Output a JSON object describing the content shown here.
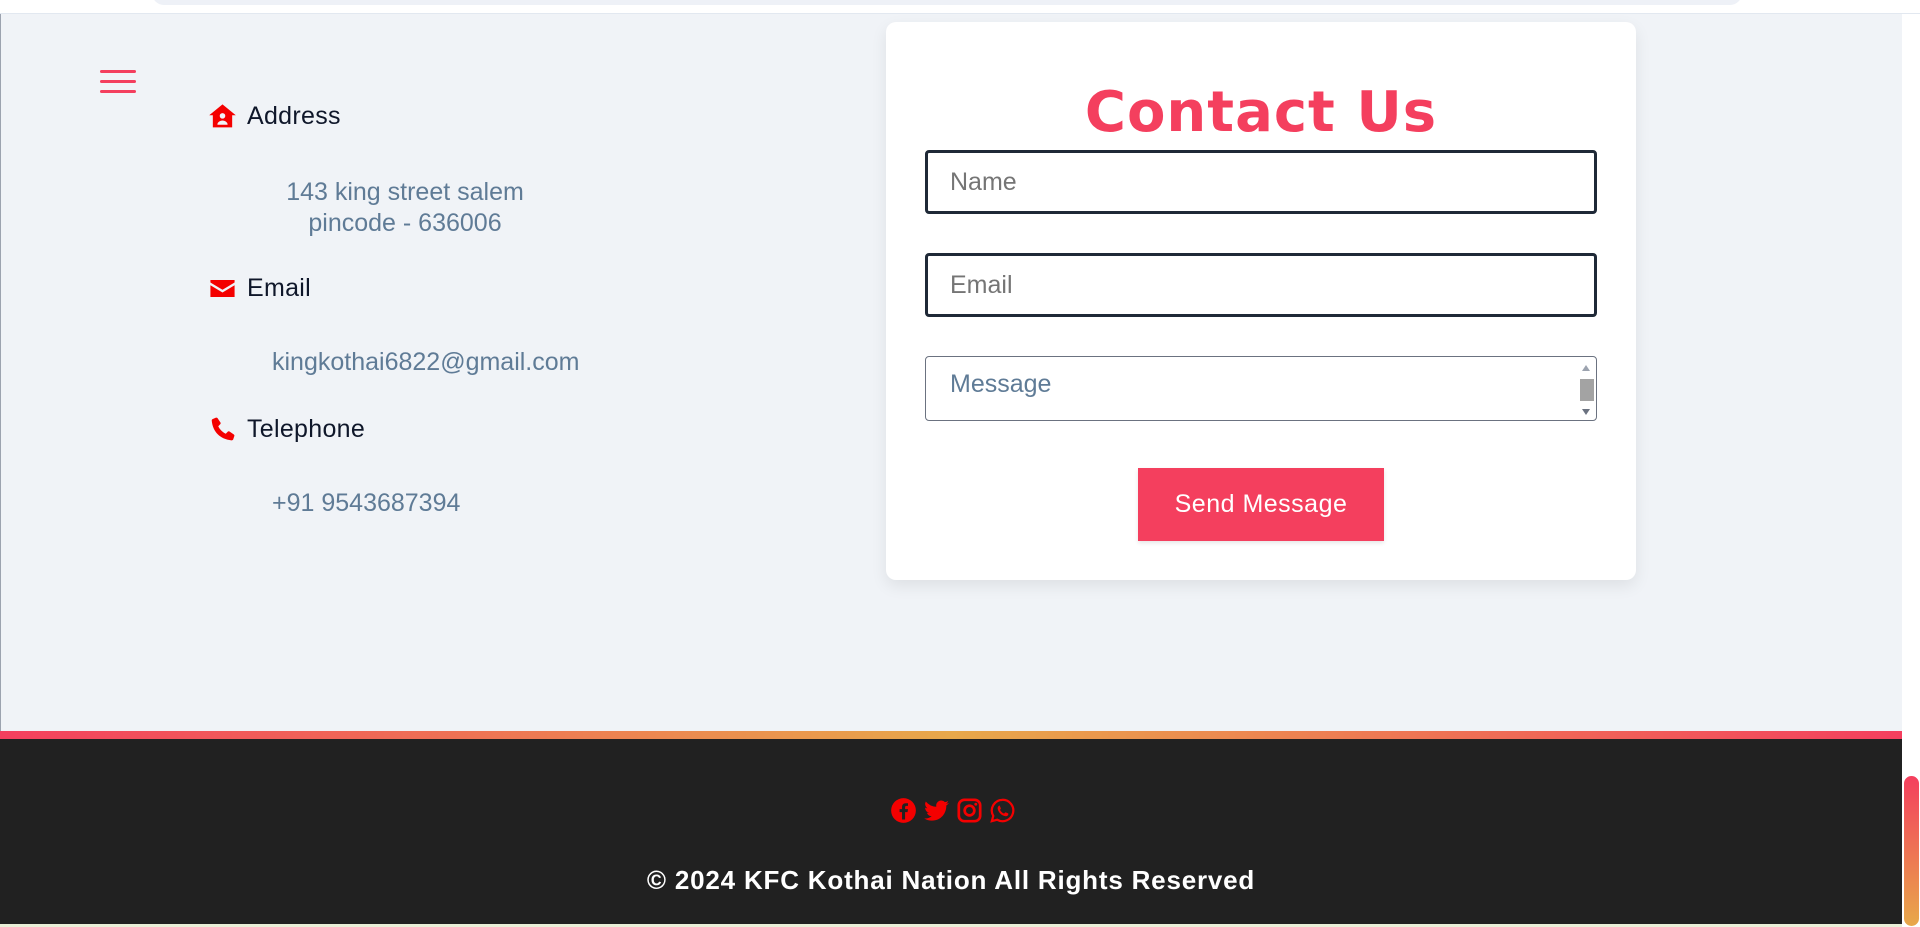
{
  "contact_info": {
    "address": {
      "heading": "Address",
      "line1": "143 king street salem",
      "line2": "pincode - 636006"
    },
    "email": {
      "heading": "Email",
      "value": "kingkothai6822@gmail.com"
    },
    "telephone": {
      "heading": "Telephone",
      "value": "+91 9543687394"
    }
  },
  "form": {
    "title": "Contact Us",
    "name_placeholder": "Name",
    "email_placeholder": "Email",
    "message_placeholder": "Message",
    "submit_label": "Send Message"
  },
  "footer": {
    "social_icons": [
      "facebook-icon",
      "twitter-icon",
      "instagram-icon",
      "whatsapp-icon"
    ],
    "copyright": "© 2024 KFC Kothai Nation All Rights Reserved"
  },
  "colors": {
    "accent": "#f43f5e",
    "icon_red": "#f40000",
    "footer_bg": "#212121",
    "page_bg": "#f0f3f7",
    "muted_text": "#5f7b96"
  }
}
